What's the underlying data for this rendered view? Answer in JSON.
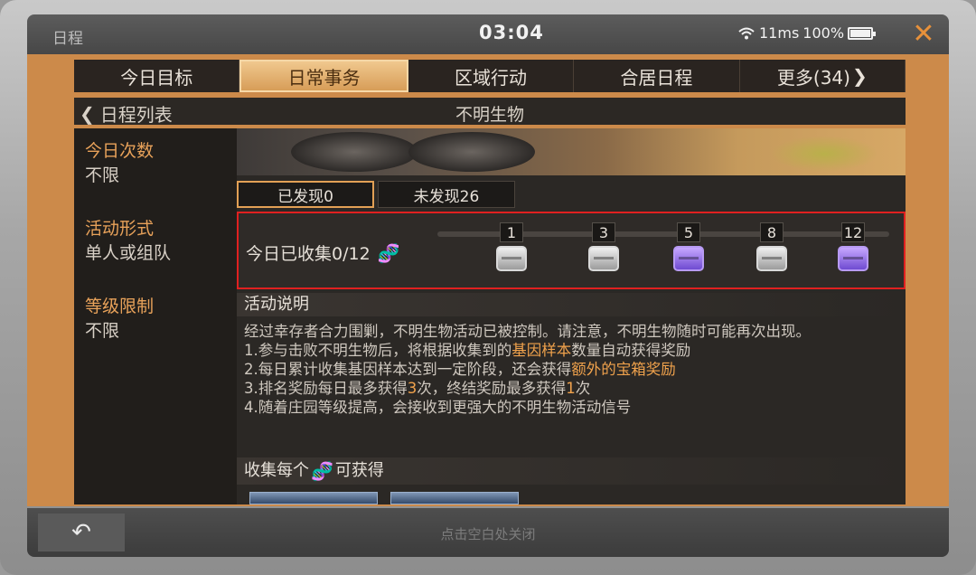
{
  "topbar": {
    "title": "日程",
    "time": "03:04",
    "signal": "11ms",
    "battery": "100%",
    "close_icon": "x-close-icon"
  },
  "tabs": [
    {
      "label": "今日目标",
      "active": false
    },
    {
      "label": "日常事务",
      "active": true
    },
    {
      "label": "区域行动",
      "active": false
    },
    {
      "label": "合居日程",
      "active": false
    },
    {
      "label": "更多(34)",
      "active": false
    }
  ],
  "subheader": {
    "back_label": "日程列表",
    "title": "不明生物"
  },
  "left_info": {
    "times_label": "今日次数",
    "times_value": "不限",
    "mode_label": "活动形式",
    "mode_value": "单人或组队",
    "level_label": "等级限制",
    "level_value": "不限"
  },
  "filters": {
    "found": "已发现0",
    "not_found": "未发现26"
  },
  "collect": {
    "label": "今日已收集0/12",
    "milestones": [
      "1",
      "3",
      "5",
      "8",
      "12"
    ],
    "chest_types": [
      "silver",
      "silver",
      "purple",
      "silver",
      "purple"
    ]
  },
  "description": {
    "header": "活动说明",
    "line0": "经过幸存者合力围剿，不明生物活动已被控制。请注意，不明生物随时可能再次出现。",
    "line1_a": "1.参与击败不明生物后，将根据收集到的",
    "line1_hl": "基因样本",
    "line1_b": "数量自动获得奖励",
    "line2_a": "2.每日累计收集基因样本达到一定阶段，还会获得",
    "line2_hl": "额外的宝箱奖励",
    "line3_a": "3.排名奖励每日最多获得",
    "line3_hl1": "3",
    "line3_b": "次，终结奖励最多获得",
    "line3_hl2": "1",
    "line3_c": "次",
    "line4": "4.随着庄园等级提高，会接收到更强大的不明生物活动信号"
  },
  "gain": {
    "label_a": "收集每个",
    "label_b": "可获得"
  },
  "bottom": {
    "hint": "点击空白处关闭"
  }
}
